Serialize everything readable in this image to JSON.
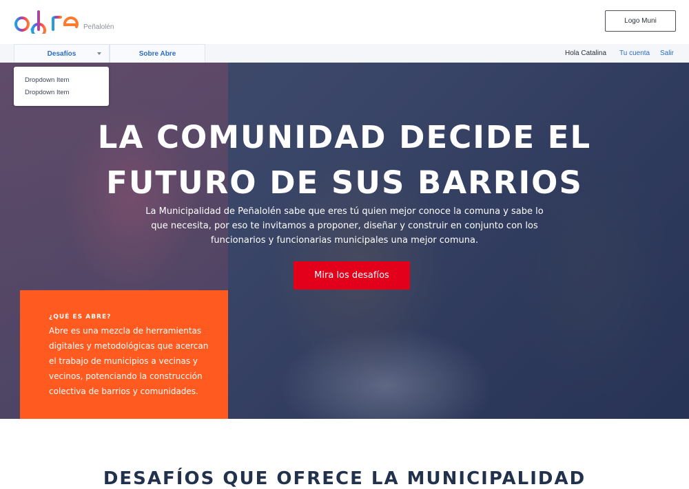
{
  "header": {
    "logo_sub": "Peñalolén",
    "logo_muni_label": "Logo Muni"
  },
  "nav": {
    "tabs": [
      {
        "label": "Desafíos"
      },
      {
        "label": "Sobre Abre"
      }
    ],
    "greeting": "Hola Catalina",
    "account_link": "Tu cuenta",
    "logout_link": "Salir"
  },
  "dropdown": {
    "items": [
      "Dropdown Item",
      "Dropdown Item"
    ]
  },
  "hero": {
    "title_line1": "LA COMUNIDAD DECIDE EL",
    "title_line2": "FUTURO DE SUS BARRIOS",
    "description": "La Municipalidad de Peñalolén sabe que eres tú quien mejor conoce la comuna y sabe lo que necesita, por eso te invitamos a proponer, diseñar y construir en conjunto con los funcionarios y funcionarias municipales una mejor comuna.",
    "cta_label": "Mira los desafíos"
  },
  "about": {
    "title": "¿QUÉ ES ABRE?",
    "text": "Abre es una mezcla de herramientas digitales y metodológicas que acercan el trabajo de municipios a vecinas y vecinos, potenciando la construcción colectiva de barrios y comunidades."
  },
  "section": {
    "heading": "DESAFÍOS QUE OFRECE LA MUNICIPALIDAD"
  },
  "colors": {
    "accent_blue": "#2b6cc4",
    "cta_red": "#e3001b",
    "about_orange": "#ff5a1f",
    "logo_colors": [
      "#1fa4e0",
      "#7b4ec9",
      "#e23d6b",
      "#ff7a2e"
    ]
  }
}
